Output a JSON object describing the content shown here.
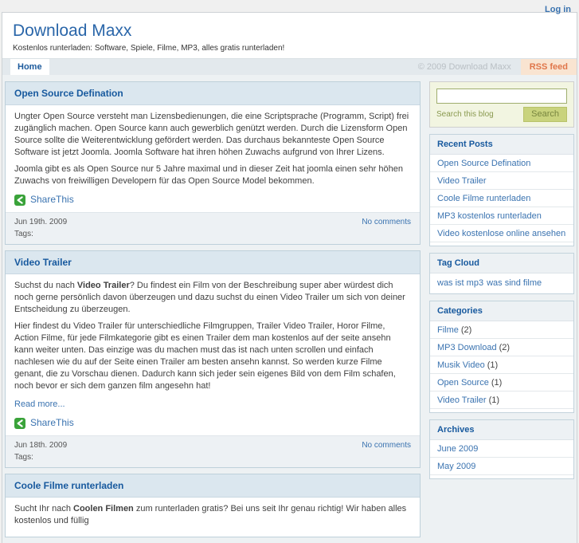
{
  "topbar": {
    "login": "Log in"
  },
  "header": {
    "title": "Download Maxx",
    "subtitle": "Kostenlos runterladen: Software, Spiele, Filme, MP3, alles gratis runterladen!"
  },
  "nav": {
    "home": "Home",
    "copyright": "© 2009 Download Maxx",
    "rss": "RSS feed"
  },
  "posts": [
    {
      "title": "Open Source Defination",
      "p1": "Ungter Open Source versteht man Lizensbedienungen, die eine Scriptsprache (Programm, Script) frei zugänglich machen. Open Source kann auch gewerblich genützt werden. Durch die Lizensform Open Source sollte die Weiterentwicklung gefördert werden. Das durchaus bekannteste Open Source Software ist jetzt Joomla. Joomla Software hat ihren höhen Zuwachs aufgrund von Ihrer Lizens.",
      "p2": "Joomla gibt es als Open Source nur 5 Jahre maximal und in dieser Zeit hat joomla einen sehr höhen Zuwachs von freiwilligen Developern für das Open Source Model bekommen.",
      "share": "ShareThis",
      "date": "Jun 19th. 2009",
      "tags_label": "Tags:",
      "comments": "No comments"
    },
    {
      "title": "Video Trailer",
      "p1_pre": "Suchst du nach ",
      "p1_bold": "Video Trailer",
      "p1_rest": "? Du findest ein Film von der Beschreibung super aber würdest dich noch gerne persönlich davon überzeugen und dazu suchst du einen Video Trailer um sich von deiner Entscheidung zu überzeugen.",
      "p2": "Hier findest du Video Trailer für unterschiedliche Filmgruppen, Trailer Video Trailer, Horor Filme, Action Filme, für jede Filmkategorie gibt es einen Trailer dem man kostenlos auf der seite ansehn kann weiter unten. Das einzige was du machen must das ist nach unten scrollen und einfach nachlesen wie du auf der Seite einen Trailer am besten ansehn kannst. So werden kurze Filme genant, die zu Vorschau dienen. Dadurch kann sich jeder sein eigenes Bild von dem Film schafen, noch bevor er sich dem ganzen film angesehn hat!",
      "read_more": "Read more...",
      "share": "ShareThis",
      "date": "Jun 18th. 2009",
      "tags_label": "Tags:",
      "comments": "No comments"
    },
    {
      "title": "Coole Filme runterladen",
      "p1_pre": "Sucht Ihr nach ",
      "p1_bold": "Coolen Filmen",
      "p1_rest": " zum runterladen gratis? Bei uns seit Ihr genau richtig! Wir haben alles kostenlos und füllig"
    }
  ],
  "sidebar": {
    "search": {
      "value": "",
      "label": "Search this blog",
      "button": "Search"
    },
    "recent_posts": {
      "title": "Recent Posts",
      "items": [
        "Open Source Defination",
        "Video Trailer",
        "Coole Filme runterladen",
        "MP3 kostenlos runterladen",
        "Video kostenlose online ansehen"
      ]
    },
    "tag_cloud": {
      "title": "Tag Cloud",
      "links": [
        "was ist mp3",
        "was sind filme"
      ]
    },
    "categories": {
      "title": "Categories",
      "items": [
        {
          "label": "Filme",
          "count": "(2)"
        },
        {
          "label": "MP3 Download",
          "count": "(2)"
        },
        {
          "label": "Musik Video",
          "count": "(1)"
        },
        {
          "label": "Open Source",
          "count": "(1)"
        },
        {
          "label": "Video Trailer",
          "count": "(1)"
        }
      ]
    },
    "archives": {
      "title": "Archives",
      "items": [
        "June 2009",
        "May 2009"
      ]
    }
  },
  "colors": {
    "post_title_blue": "#17599e",
    "link_blue": "#3a73b0",
    "rss_orange": "#e0764a",
    "share_green": "#3aa33a",
    "search_olive": "#8a9a50"
  }
}
